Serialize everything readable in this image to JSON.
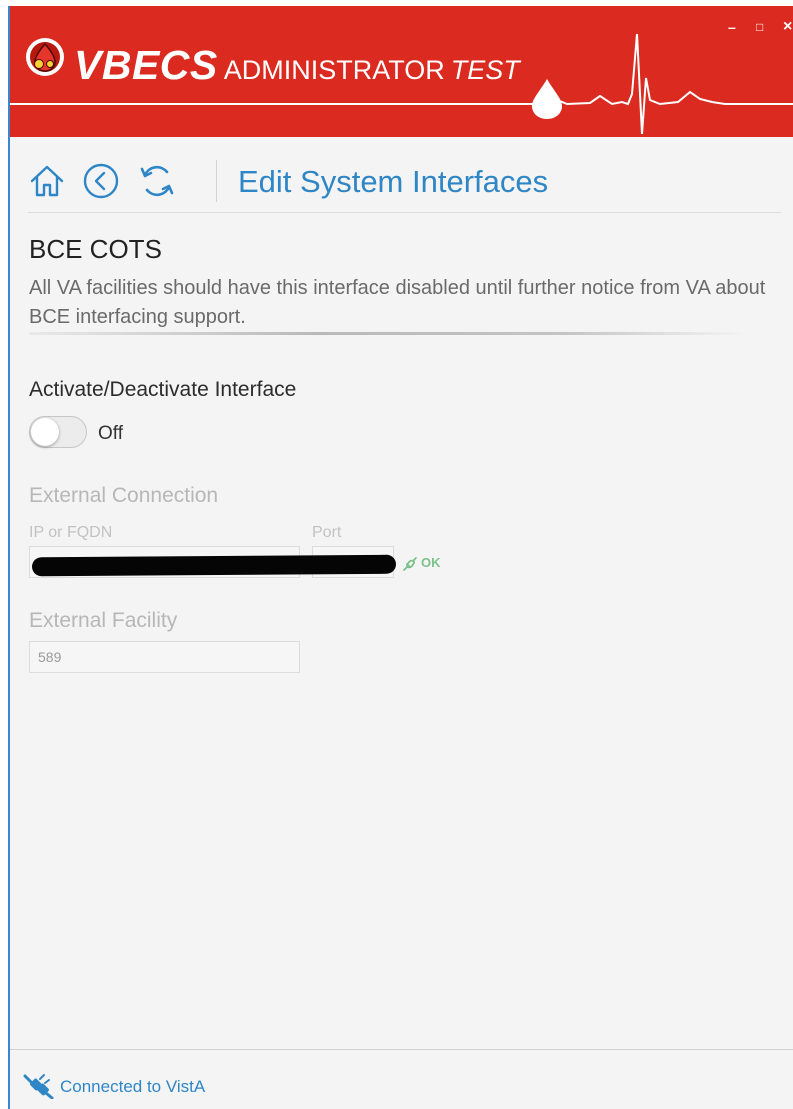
{
  "window": {
    "brand": "VBECS",
    "app_name": "ADMINISTRATOR",
    "environment": "TEST",
    "controls": {
      "minimize": "–",
      "maximize": "□",
      "close": "×"
    },
    "accent_color": "#db2a1f"
  },
  "nav": {
    "icons": [
      "home-icon",
      "back-icon",
      "refresh-icon"
    ],
    "page_title": "Edit System Interfaces"
  },
  "section": {
    "title": "BCE COTS",
    "description": "All VA facilities should have this interface disabled until further notice from VA about BCE interfacing support."
  },
  "activation": {
    "label": "Activate/Deactivate Interface",
    "state": "Off",
    "enabled": false
  },
  "external_connection": {
    "title": "External Connection",
    "ip_label": "IP or FQDN",
    "port_label": "Port",
    "status": "OK"
  },
  "external_facility": {
    "title": "External Facility",
    "value": "589"
  },
  "status_bar": {
    "text": "Connected to VistA"
  }
}
